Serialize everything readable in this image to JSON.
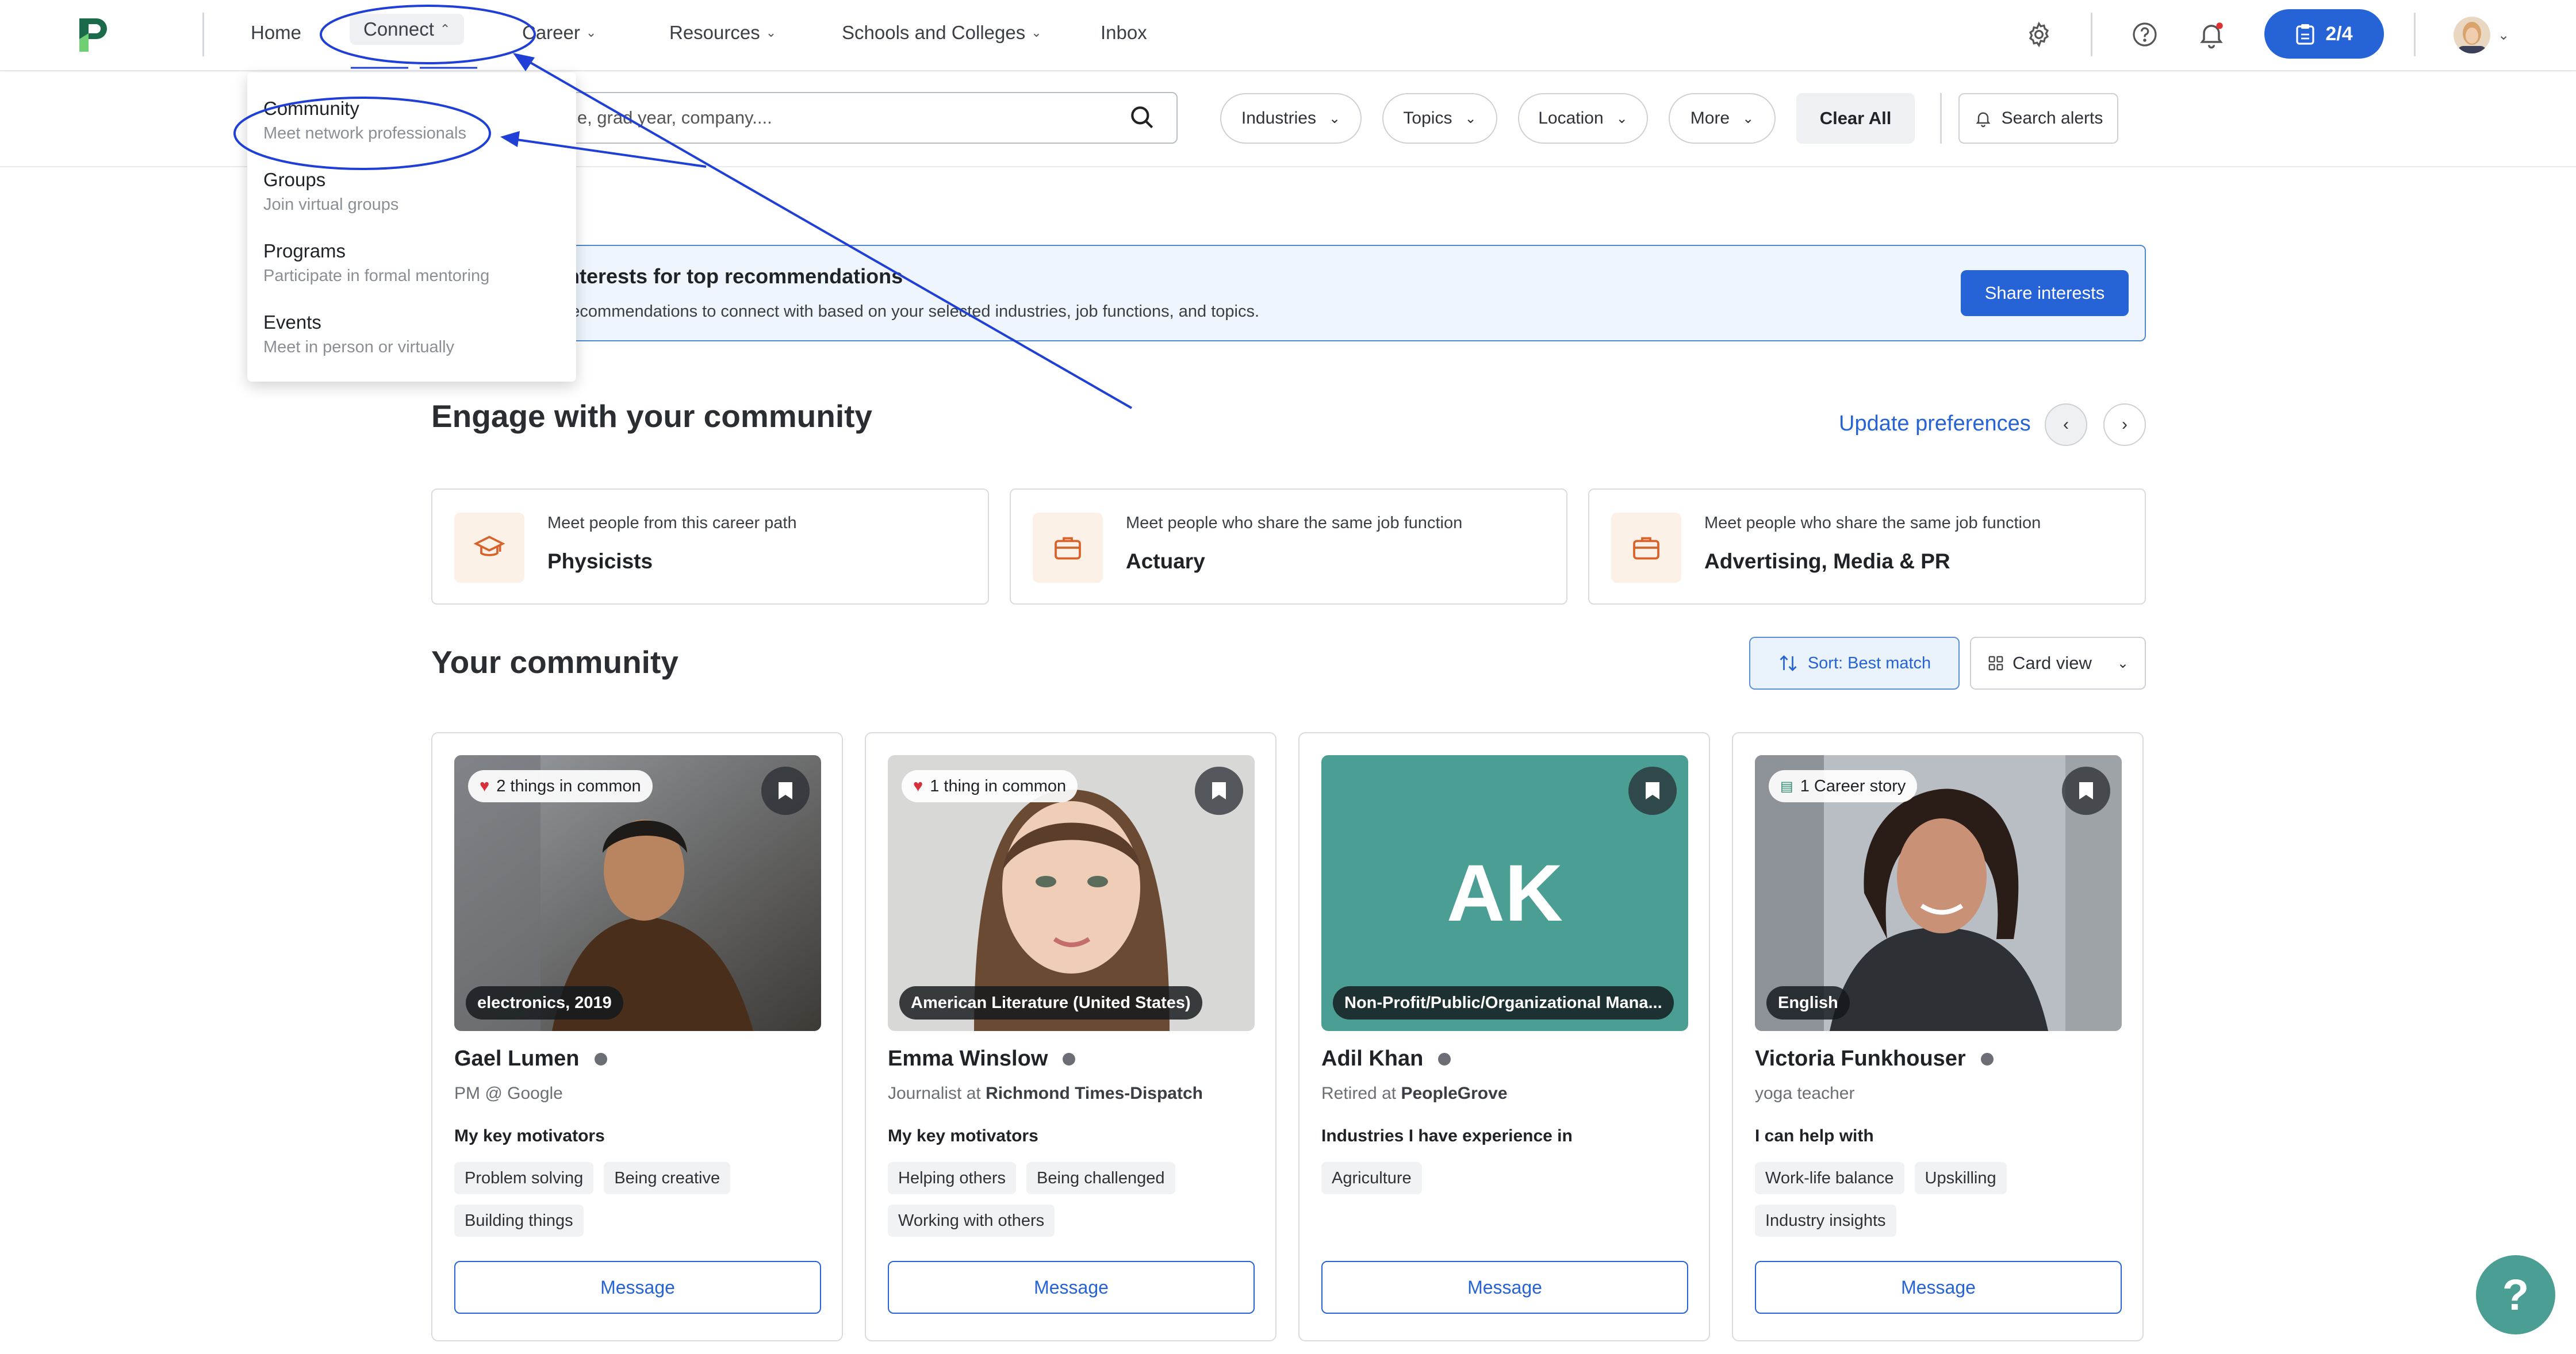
{
  "nav": {
    "home": "Home",
    "connect": "Connect",
    "career": "Career",
    "resources": "Resources",
    "schools": "Schools and Colleges",
    "inbox": "Inbox",
    "progress": "2/4"
  },
  "dropdown": [
    {
      "title": "Community",
      "desc": "Meet network professionals"
    },
    {
      "title": "Groups",
      "desc": "Join virtual groups"
    },
    {
      "title": "Programs",
      "desc": "Participate in formal mentoring"
    },
    {
      "title": "Events",
      "desc": "Meet in person or virtually"
    }
  ],
  "filters": {
    "search_value": "me, grad year, company....",
    "industries": "Industries",
    "topics": "Topics",
    "location": "Location",
    "more": "More",
    "clear_all": "Clear All",
    "search_alerts": "Search alerts"
  },
  "banner": {
    "title": "r interests for top recommendations",
    "subtitle": "le recommendations to connect with based on your selected industries, job functions, and topics.",
    "share_button": "Share interests"
  },
  "engage": {
    "title": "Engage with your community",
    "update_link": "Update preferences",
    "cards": [
      {
        "sub": "Meet people from this career path",
        "title": "Physicists"
      },
      {
        "sub": "Meet people who share the same job function",
        "title": "Actuary"
      },
      {
        "sub": "Meet people who share the same job function",
        "title": "Advertising, Media & PR"
      }
    ]
  },
  "community": {
    "title": "Your community",
    "sort": "Sort: Best match",
    "view": "Card view",
    "people": [
      {
        "chip": "2 things in common",
        "tag": "electronics, 2019",
        "name": "Gael Lumen",
        "role_plain": "PM @ Google",
        "role_at": "",
        "role_org": "",
        "section": "My key motivators",
        "tags": [
          "Problem solving",
          "Being creative",
          "Building things"
        ],
        "button": "Message"
      },
      {
        "chip": "1 thing in common",
        "tag": "American Literature (United States)",
        "name": "Emma Winslow",
        "role_plain": "",
        "role_at": "Journalist",
        "role_org": "Richmond Times-Dispatch",
        "section": "My key motivators",
        "tags": [
          "Helping others",
          "Being challenged",
          "Working with others"
        ],
        "button": "Message"
      },
      {
        "chip": "",
        "initials": "AK",
        "tag": "Non-Profit/Public/Organizational Mana...",
        "name": "Adil Khan",
        "role_plain": "",
        "role_at": "Retired",
        "role_org": "PeopleGrove",
        "section": "Industries I have experience in",
        "tags": [
          "Agriculture"
        ],
        "button": "Message"
      },
      {
        "chip": "1 Career story",
        "tag": "English",
        "name": "Victoria Funkhouser",
        "role_plain": "yoga teacher",
        "role_at": "",
        "role_org": "",
        "section": "I can help with",
        "tags": [
          "Work-life balance",
          "Upskilling",
          "Industry insights"
        ],
        "button": "Message"
      }
    ],
    "at_word": "at"
  },
  "help_fab": "?",
  "colors": {
    "primary": "#2563d6",
    "annotation": "#1f3fd6",
    "teal": "#4a9e94"
  }
}
